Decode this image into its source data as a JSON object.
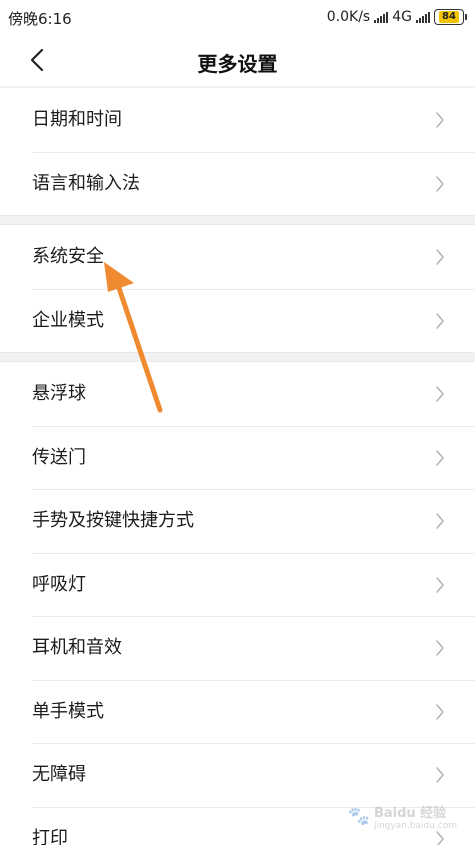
{
  "status_bar": {
    "time": "傍晚6:16",
    "network_speed": "0.0K/s",
    "network_type": "4G",
    "battery": "84"
  },
  "header": {
    "title": "更多设置",
    "back_icon": "back-chevron-icon"
  },
  "groups": [
    {
      "items": [
        {
          "label": "日期和时间"
        },
        {
          "label": "语言和输入法"
        }
      ]
    },
    {
      "items": [
        {
          "label": "系统安全"
        },
        {
          "label": "企业模式"
        }
      ]
    },
    {
      "items": [
        {
          "label": "悬浮球"
        },
        {
          "label": "传送门"
        },
        {
          "label": "手势及按键快捷方式"
        },
        {
          "label": "呼吸灯"
        },
        {
          "label": "耳机和音效"
        },
        {
          "label": "单手模式"
        },
        {
          "label": "无障碍"
        },
        {
          "label": "打印"
        }
      ]
    }
  ],
  "annotation": {
    "color": "#f08a30",
    "points_to": "系统安全"
  },
  "watermark": {
    "text": "Baidu 经验",
    "sub": "jingyan.baidu.com"
  }
}
